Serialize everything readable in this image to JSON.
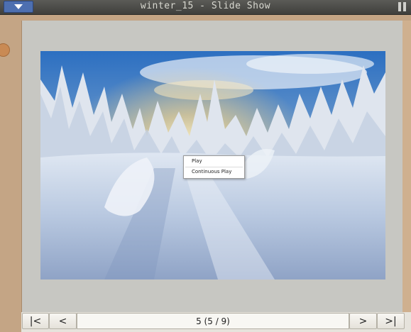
{
  "window": {
    "title": "winter_15 - Slide Show"
  },
  "photo": {
    "description_icon": "image"
  },
  "context_menu": {
    "items": [
      "Play",
      "Continuous Play"
    ]
  },
  "navigation": {
    "first_label": "|<",
    "prev_label": "<",
    "counter": "5 (5 / 9)",
    "next_label": ">",
    "last_label": ">|"
  },
  "colors": {
    "accent": "#4d6fb0",
    "frame": "#c4a585",
    "viewer_bg": "#c7c7c2"
  }
}
